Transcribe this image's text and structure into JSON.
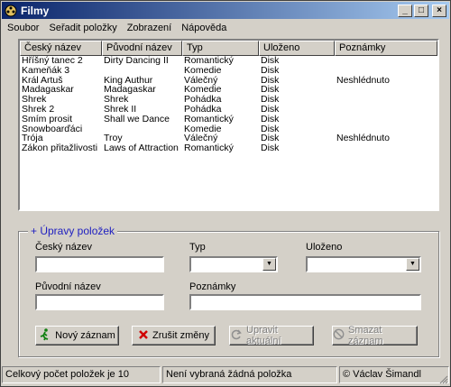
{
  "window": {
    "title": "Filmy"
  },
  "menu": [
    "Soubor",
    "Seřadit položky",
    "Zobrazení",
    "Nápověda"
  ],
  "list": {
    "columns": [
      "Český název",
      "Původní název",
      "Typ",
      "Uloženo",
      "Poznámky"
    ],
    "rows": [
      [
        "Hříšný tanec 2",
        "Dirty Dancing II",
        "Romantický",
        "Disk",
        ""
      ],
      [
        "Kameňák 3",
        "",
        "Komedie",
        "Disk",
        ""
      ],
      [
        "Král Artuš",
        "King Authur",
        "Válečný",
        "Disk",
        "Neshlédnuto"
      ],
      [
        "Madagaskar",
        "Madagaskar",
        "Komedie",
        "Disk",
        ""
      ],
      [
        "Shrek",
        "Shrek",
        "Pohádka",
        "Disk",
        ""
      ],
      [
        "Shrek 2",
        "Shrek II",
        "Pohádka",
        "Disk",
        ""
      ],
      [
        "Smím prosit",
        "Shall we Dance",
        "Romantický",
        "Disk",
        ""
      ],
      [
        "Snowboarďáci",
        "",
        "Komedie",
        "Disk",
        ""
      ],
      [
        "Trója",
        "Troy",
        "Válečný",
        "Disk",
        "Neshlédnuto"
      ],
      [
        "Zákon přitažlivosti",
        "Laws of Attraction",
        "Romantický",
        "Disk",
        ""
      ]
    ]
  },
  "edit": {
    "title": "+ Úpravy položek",
    "cesky_label": "Český název",
    "typ_label": "Typ",
    "ulozeno_label": "Uloženo",
    "puvodni_label": "Původní název",
    "poznamky_label": "Poznámky",
    "cesky_value": "",
    "puvodni_value": "",
    "typ_value": "",
    "ulozeno_value": "",
    "poznamky_value": ""
  },
  "buttons": {
    "new": "Nový záznam",
    "cancel": "Zrušit změny",
    "update": "Upravit aktuální",
    "delete": "Smazat záznam"
  },
  "status": {
    "count": "Celkový počet položek je 10",
    "selection": "Není vybraná žádná položka",
    "author": "© Václav Šimandl"
  },
  "colors": {
    "titlebar_start": "#0a246a",
    "titlebar_end": "#a6caf0",
    "group_title": "#2020c0",
    "face": "#d4d0c8"
  }
}
